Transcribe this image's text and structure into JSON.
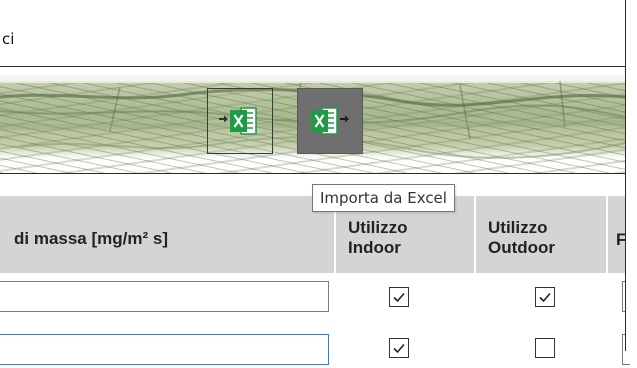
{
  "window": {
    "title_fragment": "ci"
  },
  "toolbar": {
    "buttons": [
      {
        "id": "export",
        "icon": "excel-export-icon",
        "state": "normal"
      },
      {
        "id": "import",
        "icon": "excel-import-icon",
        "state": "hovered"
      }
    ],
    "tooltip": "Importa da Excel"
  },
  "table": {
    "columns": [
      {
        "label": "di massa [mg/m² s]"
      },
      {
        "label_line1": "Utilizzo",
        "label_line2": "Indoor"
      },
      {
        "label_line1": "Utilizzo",
        "label_line2": "Outdoor"
      },
      {
        "label": "F"
      }
    ],
    "rows": [
      {
        "value": "",
        "indoor": true,
        "outdoor": true
      },
      {
        "value": "",
        "indoor": true,
        "outdoor": false
      }
    ]
  },
  "colors": {
    "excel_green": "#1e9b43",
    "header_bg": "#d4d4d4",
    "hover_button_bg": "#6f6f6f",
    "focus_border": "#2f7fd4"
  }
}
